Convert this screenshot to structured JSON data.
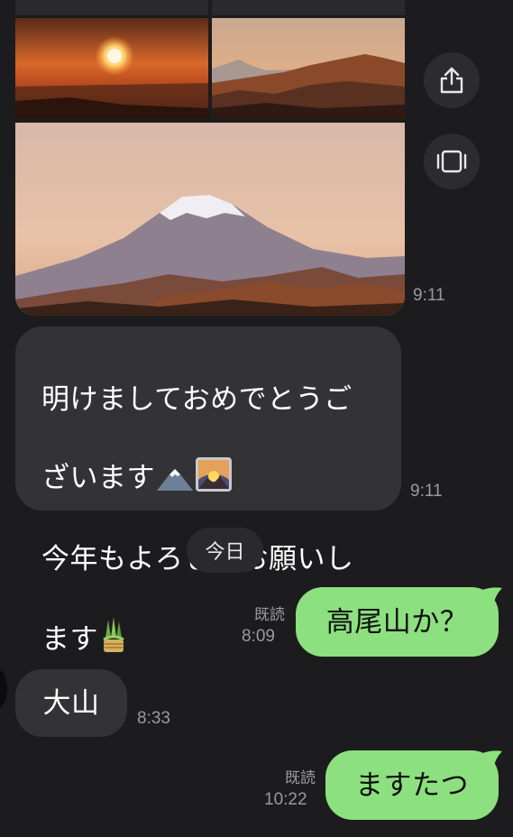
{
  "chat": {
    "photo_time": "9:11",
    "greeting": {
      "line1": "明けましておめでとうご",
      "line2": "ざいます",
      "line3": "今年もよろしくお願いし",
      "line4": "ます",
      "time": "9:11",
      "emoji_names": [
        "mount-fuji-icon",
        "sunrise-over-mountains-icon",
        "kadomatsu-icon"
      ]
    },
    "date_divider": "今日",
    "messages": [
      {
        "side": "out",
        "text": "高尾山か？",
        "read": "既読",
        "time": "8:09"
      },
      {
        "side": "in",
        "text": "大山",
        "time": "8:33"
      },
      {
        "side": "out",
        "text": "ますたつ",
        "read": "既読",
        "time": "10:22"
      }
    ]
  },
  "actions": {
    "share_icon": "share-icon",
    "expand_icon": "gallery-expand-icon"
  },
  "colors": {
    "background": "#1c1c1e",
    "incoming_bubble": "#333335",
    "outgoing_bubble": "#8de07f",
    "meta_text": "#9a9a9e"
  }
}
